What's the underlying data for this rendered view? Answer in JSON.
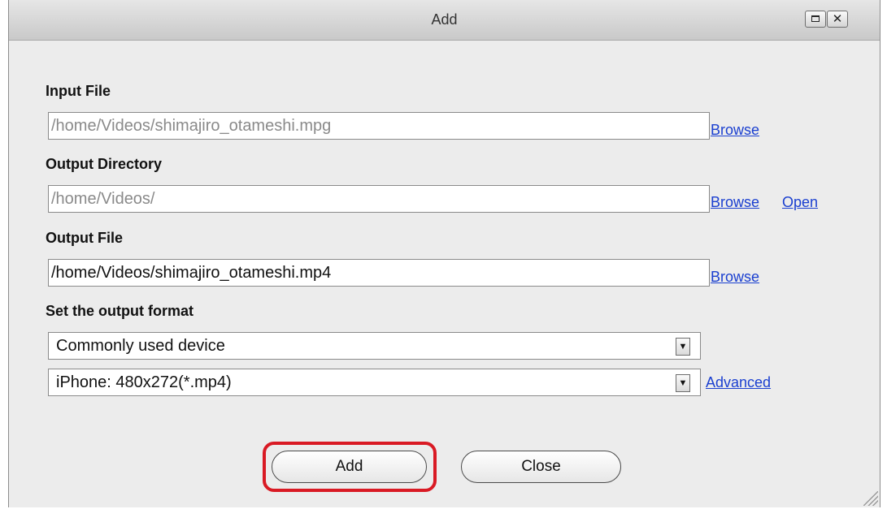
{
  "window": {
    "title": "Add",
    "maximize_icon": "maximize-icon",
    "close_icon": "close-icon",
    "close_glyph": "✕"
  },
  "input_file": {
    "label": "Input File",
    "value": "/home/Videos/shimajiro_otameshi.mpg",
    "browse_label": "Browse"
  },
  "output_directory": {
    "label": "Output Directory",
    "value": "/home/Videos/",
    "browse_label": "Browse",
    "open_label": "Open"
  },
  "output_file": {
    "label": "Output File",
    "value": "/home/Videos/shimajiro_otameshi.mp4",
    "browse_label": "Browse"
  },
  "output_format": {
    "label": "Set the output format",
    "category_selected": "Commonly used device",
    "preset_selected": "iPhone: 480x272(*.mp4)",
    "advanced_label": "Advanced",
    "dropdown_glyph": "▼"
  },
  "buttons": {
    "add_label": "Add",
    "close_label": "Close"
  },
  "colors": {
    "link": "#1a3fd0",
    "highlight": "#d91a24",
    "background": "#ececec"
  }
}
